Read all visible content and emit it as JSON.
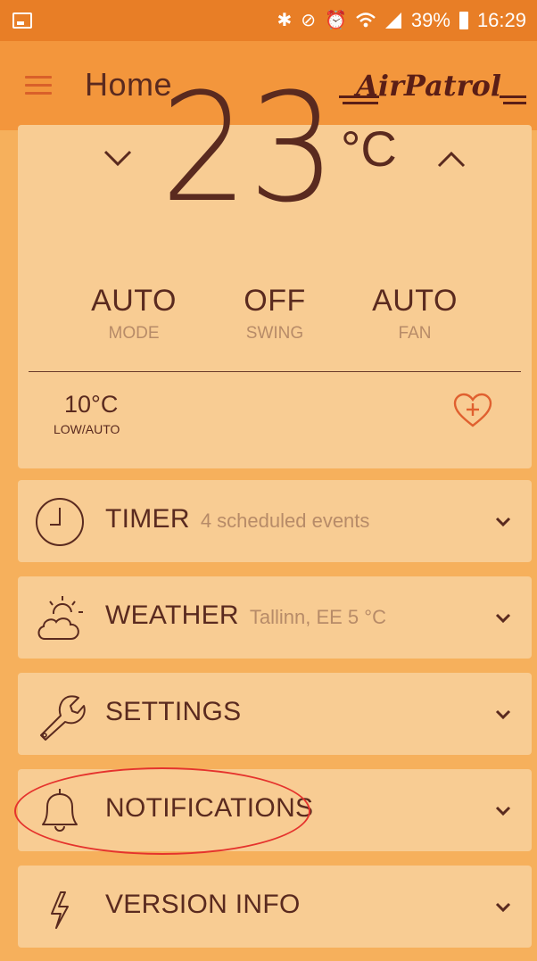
{
  "status_bar": {
    "icons": [
      "gallery-icon",
      "bluetooth-icon",
      "mute-icon",
      "alarm-icon",
      "wifi-icon",
      "signal-icon"
    ],
    "battery_percent": "39%",
    "time": "16:29"
  },
  "app_bar": {
    "title": "Home",
    "brand": "AirPatrol"
  },
  "thermostat": {
    "temperature": "23",
    "unit": "°C",
    "mode": {
      "value": "AUTO",
      "label": "MODE"
    },
    "swing": {
      "value": "OFF",
      "label": "SWING"
    },
    "fan": {
      "value": "AUTO",
      "label": "FAN"
    },
    "setback": {
      "value": "10°C",
      "label": "LOW/AUTO"
    }
  },
  "menu": {
    "timer": {
      "label": "TIMER",
      "detail": "4 scheduled events"
    },
    "weather": {
      "label": "WEATHER",
      "detail": "Tallinn, EE 5 °C"
    },
    "settings": {
      "label": "SETTINGS"
    },
    "notifications": {
      "label": "NOTIFICATIONS"
    },
    "version": {
      "label": "VERSION INFO"
    }
  },
  "colors": {
    "status_bar": "#e87e26",
    "app_bar": "#f3963c",
    "background": "#f6b05c",
    "card": "#f8cc93",
    "text": "#5a2a1f",
    "muted": "#b78b68",
    "highlight_circle": "#e5332d"
  }
}
